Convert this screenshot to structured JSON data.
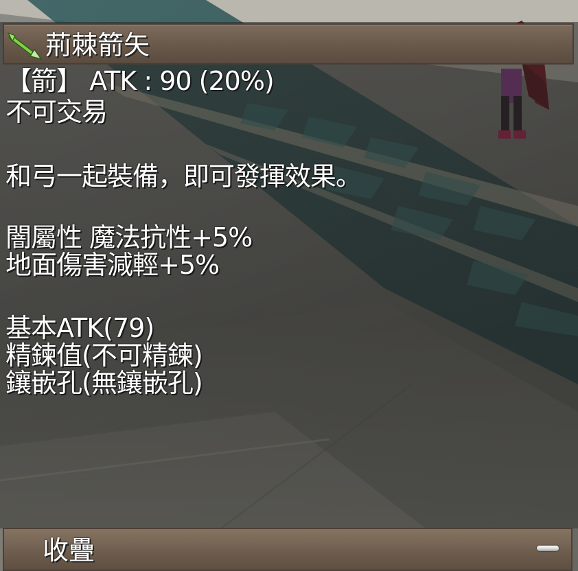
{
  "item": {
    "icon": "arrow-icon",
    "name": "荊棘箭矢"
  },
  "details": {
    "type_line": "【箭】 ATK : 90 (20%)",
    "trade": "不可交易",
    "equip_note": "和弓一起裝備，即可發揮效果。",
    "effect_1": "闇屬性 魔法抗性+5%",
    "effect_2": "地面傷害減輕+5%",
    "base_atk": "基本ATK(79)",
    "refine": "精鍊值(不可精鍊)",
    "socket": "鑲嵌孔(無鑲嵌孔)"
  },
  "footer": {
    "collapse_label": "收疊",
    "collapse_icon": "minus-icon"
  },
  "colors": {
    "text": "#ffffff",
    "bar": "#6f5e4e",
    "arrow_shaft": "#6ab83a"
  }
}
